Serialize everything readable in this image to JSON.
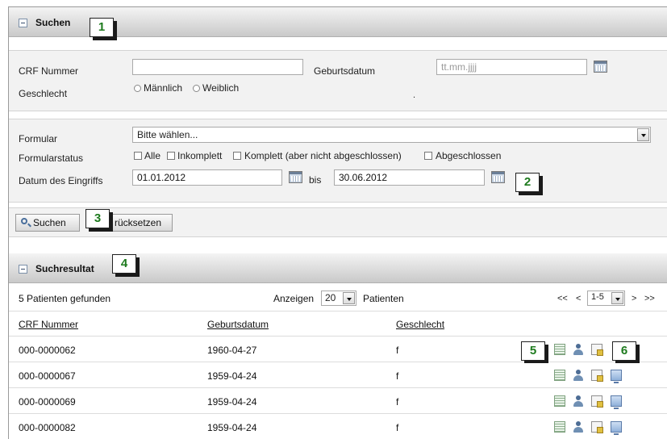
{
  "search_section": {
    "title": "Suchen",
    "callout": "1"
  },
  "patient_fields": {
    "crf_label": "CRF Nummer",
    "crf_value": "",
    "geburtsdatum_label": "Geburtsdatum",
    "geburtsdatum_placeholder": "tt.mm.jjjj",
    "geschlecht_label": "Geschlecht",
    "male_label": "Männlich",
    "female_label": "Weiblich",
    "dot": "."
  },
  "form_fields": {
    "formular_label": "Formular",
    "formular_value": "Bitte wählen...",
    "status_label": "Formularstatus",
    "status_options": [
      "Alle",
      "Inkomplett",
      "Komplett (aber nicht abgeschlossen)",
      "Abgeschlossen"
    ],
    "datum_label": "Datum des Eingriffs",
    "datum_from": "01.01.2012",
    "bis_label": "bis",
    "datum_to": "30.06.2012",
    "callout": "2"
  },
  "actions": {
    "search_label": "Suchen",
    "callout": "3",
    "reset_label": "rücksetzen"
  },
  "results_section": {
    "title": "Suchresultat",
    "callout": "4"
  },
  "results_bar": {
    "found_text": "5 Patienten gefunden",
    "show_label": "Anzeigen",
    "page_size": "20",
    "patients_label": "Patienten",
    "first": "<<",
    "prev": "<",
    "range": "1-5",
    "next": ">",
    "last": ">>"
  },
  "table": {
    "headers": [
      "CRF Nummer",
      "Geburtsdatum",
      "Geschlecht"
    ],
    "rows": [
      {
        "crf": "000-0000062",
        "dob": "1960-04-27",
        "sex": "f"
      },
      {
        "crf": "000-0000067",
        "dob": "1959-04-24",
        "sex": "f"
      },
      {
        "crf": "000-0000069",
        "dob": "1959-04-24",
        "sex": "f"
      },
      {
        "crf": "000-0000082",
        "dob": "1959-04-24",
        "sex": "f"
      }
    ],
    "callout_left": "5",
    "callout_right": "6",
    "row_icons": [
      "form-list-icon",
      "patient-icon",
      "add-document-icon",
      "monitor-icon"
    ]
  }
}
